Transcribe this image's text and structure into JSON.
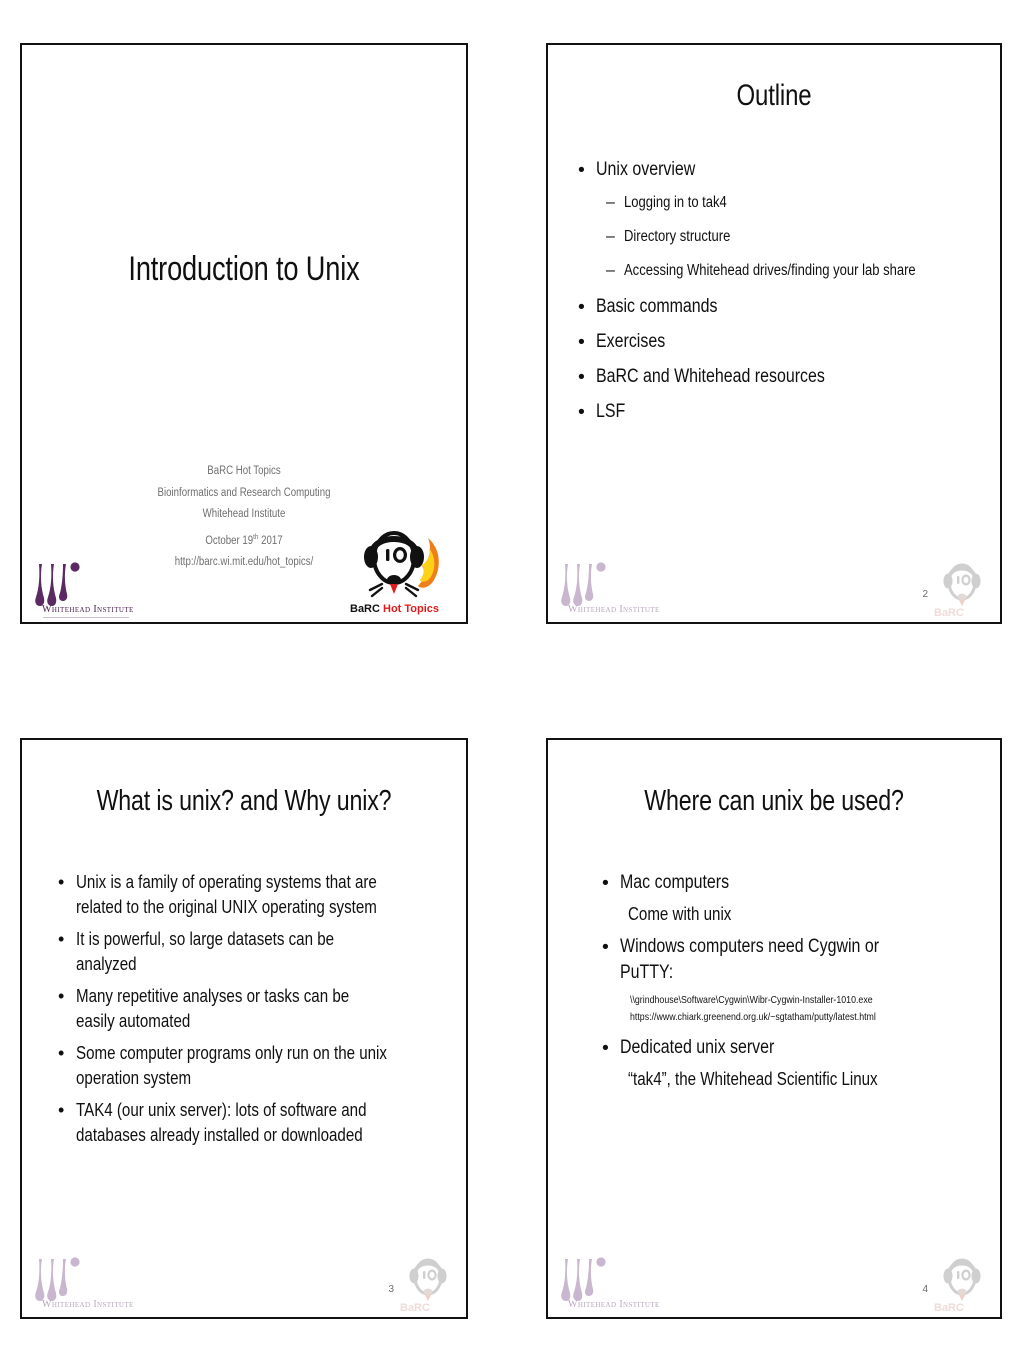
{
  "document": {
    "kind": "slide-handout",
    "slides_per_page": 4
  },
  "colors": {
    "slide_border": "#121212",
    "text": "#101010",
    "meta_text": "#6f6f6f",
    "whitehead_purple": "#4b2050",
    "whitehead_mark_purple": "#5b2a63",
    "barc_red": "#e01b1b",
    "page_number": "#6b6b6b"
  },
  "slide1": {
    "title": "Introduction to Unix",
    "meta": {
      "line1": "BaRC Hot Topics",
      "line2": "Bioinformatics and Research Computing",
      "line3": "Whitehead Institute",
      "date_main": "October 19",
      "date_sup": "th",
      "date_year": " 2017",
      "url": "http://barc.wi.mit.edu/hot_topics/"
    },
    "footer": {
      "whitehead_label": "Whitehead Institute",
      "barc_label_dark": "BaRC ",
      "barc_label_red": "Hot Topics",
      "barc_headphone_number": "10",
      "page_number": ""
    }
  },
  "slide2": {
    "title": "Outline",
    "bullets": [
      {
        "level": 1,
        "marker": "•",
        "text": "Unix overview"
      },
      {
        "level": 2,
        "marker": "–",
        "text": "Logging in to tak4"
      },
      {
        "level": 2,
        "marker": "–",
        "text": "Directory structure"
      },
      {
        "level": 2,
        "marker": "–",
        "text": "Accessing Whitehead drives/finding your lab share"
      },
      {
        "level": 1,
        "marker": "•",
        "text": "Basic commands"
      },
      {
        "level": 1,
        "marker": "•",
        "text": "Exercises"
      },
      {
        "level": 1,
        "marker": "•",
        "text": "BaRC and Whitehead resources"
      },
      {
        "level": 1,
        "marker": "•",
        "text": "LSF"
      }
    ],
    "footer": {
      "whitehead_label": "Whitehead Institute",
      "barc_headphone_number": "10",
      "barc_label": "BaRC",
      "page_number": "2"
    }
  },
  "slide3": {
    "title": "What is unix? and Why unix?",
    "bullets": [
      {
        "level": 1,
        "marker": "•",
        "text": "Unix is a family of operating systems that are related to the original UNIX operating system"
      },
      {
        "level": 1,
        "marker": "•",
        "text": "It is powerful, so large datasets can be analyzed"
      },
      {
        "level": 1,
        "marker": "•",
        "text": "Many repetitive analyses or tasks can be easily automated"
      },
      {
        "level": 1,
        "marker": "•",
        "text": "Some computer programs only run on the unix operation system"
      },
      {
        "level": 1,
        "marker": "•",
        "text": "TAK4 (our unix server): lots of software and databases already installed or downloaded"
      }
    ],
    "footer": {
      "whitehead_label": "Whitehead Institute",
      "barc_headphone_number": "10",
      "barc_label": "BaRC",
      "page_number": "3"
    }
  },
  "slide4": {
    "title": "Where can unix be used?",
    "blocks": [
      {
        "style": "bullet",
        "marker": "•",
        "text": "Mac computers"
      },
      {
        "style": "plain",
        "text": "Come with unix"
      },
      {
        "style": "bullet",
        "marker": "•",
        "text": "Windows computers need Cygwin or PuTTY:"
      },
      {
        "style": "small",
        "text": "\\\\grindhouse\\Software\\Cygwin\\Wibr-Cygwin-Installer-1010.exe"
      },
      {
        "style": "small",
        "text": "https://www.chiark.greenend.org.uk/~sgtatham/putty/latest.html"
      },
      {
        "style": "bullet",
        "marker": "•",
        "text": "Dedicated unix server"
      },
      {
        "style": "plain",
        "text": "“tak4”, the Whitehead Scientific Linux"
      }
    ],
    "footer": {
      "whitehead_label": "Whitehead Institute",
      "barc_headphone_number": "10",
      "barc_label": "BaRC",
      "page_number": "4"
    }
  }
}
